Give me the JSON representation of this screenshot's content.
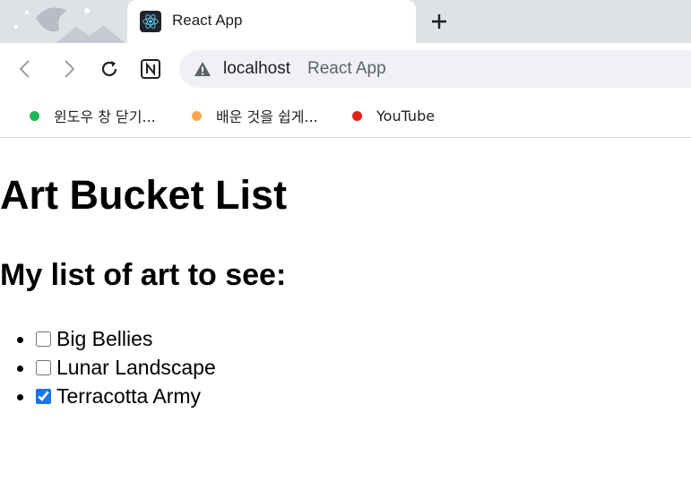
{
  "browser": {
    "tab": {
      "title": "React App"
    },
    "toolbar": {
      "url_host": "localhost",
      "url_title": "React App"
    },
    "bookmarks": [
      {
        "label": "윈도우 창 닫기...",
        "color": "#1db954"
      },
      {
        "label": "배운 것을 쉽게...",
        "color": "#f4a64a"
      },
      {
        "label": "YouTube",
        "color": "#e62117"
      }
    ]
  },
  "page": {
    "heading": "Art Bucket List",
    "subheading": "My list of art to see:",
    "items": [
      {
        "title": "Big Bellies",
        "seen": false
      },
      {
        "title": "Lunar Landscape",
        "seen": false
      },
      {
        "title": "Terracotta Army",
        "seen": true
      }
    ]
  }
}
